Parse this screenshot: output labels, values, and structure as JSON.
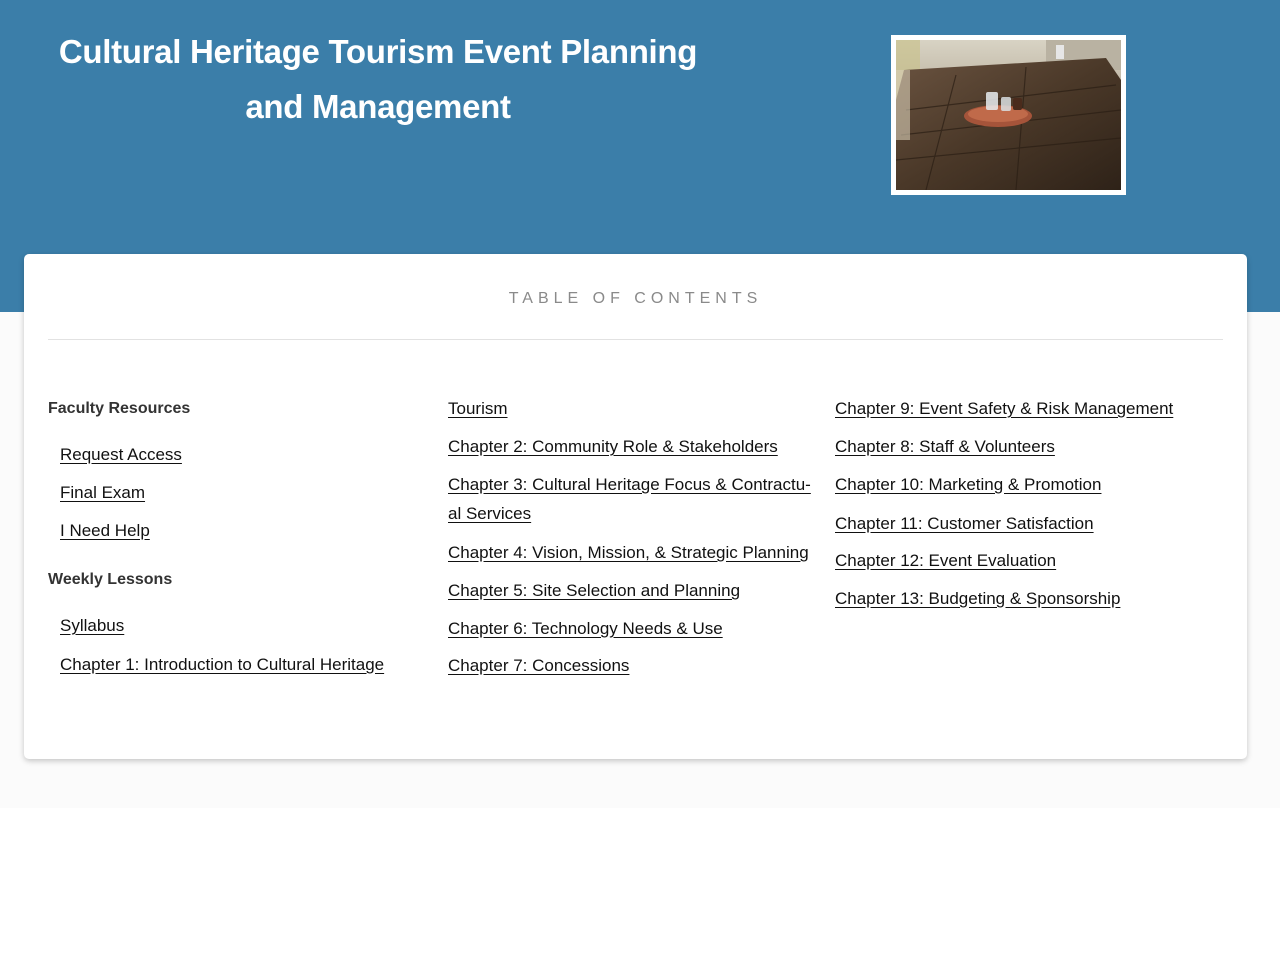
{
  "header": {
    "title": "Cultural Heritage Tourism Event Planning and Management",
    "photo_alt": "rustic wooden table with a tray of glasses"
  },
  "toc": {
    "heading": "TABLE OF CONTENTS",
    "faculty": {
      "heading": "Faculty Resources",
      "links": [
        "Request Access",
        "Final Exam",
        "I Need Help"
      ]
    },
    "weekly": {
      "heading": "Weekly Lessons",
      "links": [
        "Syllabus",
        "Chapter 1: Introduction to Cultural Heritage"
      ]
    },
    "middle": [
      "Tourism",
      "Chapter 2: Community Role & Stakeholders",
      "Chapter 3: Cultural Heritage Focus & Contractu-al Services",
      "Chapter 4: Vision, Mission, & Strategic Planning",
      "Chapter 5: Site Selection and Planning",
      "Chapter 6: Technology Needs & Use",
      "Chapter 7: Concessions"
    ],
    "right": [
      "Chapter 9: Event Safety & Risk Management",
      "Chapter 8: Staff & Volunteers",
      "Chapter 10: Marketing & Promotion",
      "Chapter 11: Customer Satisfaction",
      "Chapter 12: Event Evaluation",
      "Chapter 13: Budgeting & Sponsorship"
    ]
  },
  "colors": {
    "hero": "#3b7ea9",
    "link": "#111111",
    "heading_muted": "#8a8a8a"
  }
}
